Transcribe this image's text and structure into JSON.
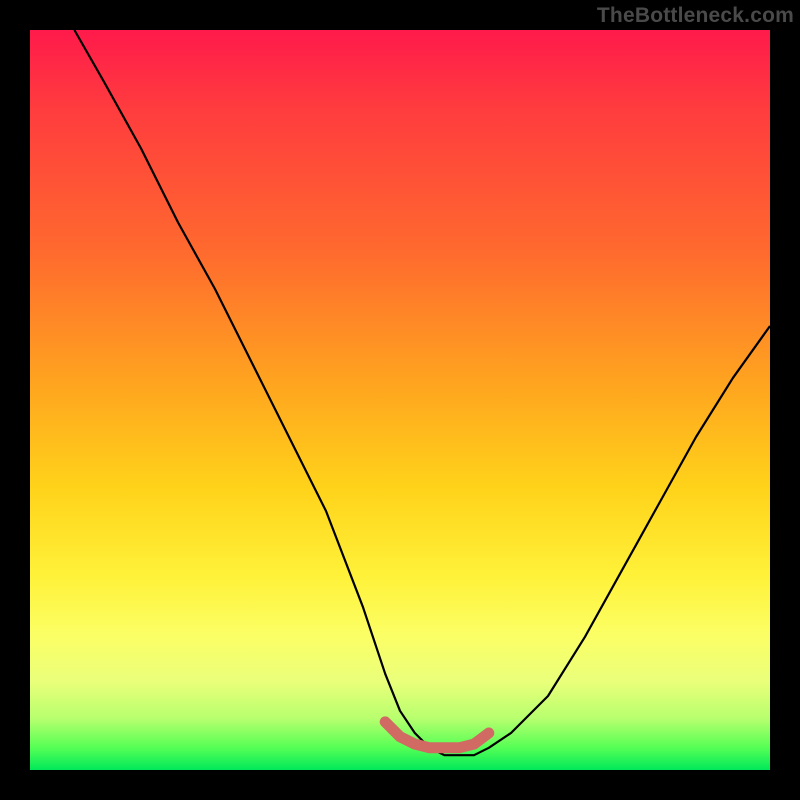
{
  "watermark": "TheBottleneck.com",
  "colors": {
    "gradient_top": "#ff1a4b",
    "gradient_mid1": "#ff6a2e",
    "gradient_mid2": "#ffd31a",
    "gradient_mid3": "#fbff66",
    "gradient_bottom": "#00e85a",
    "curve": "#000000",
    "marker": "#d16a63",
    "frame": "#000000"
  },
  "chart_data": {
    "type": "line",
    "title": "",
    "xlabel": "",
    "ylabel": "",
    "xlim": [
      0,
      100
    ],
    "ylim": [
      0,
      100
    ],
    "grid": false,
    "legend": false,
    "notes": "Axes are percentage-of-plot coordinates estimated from pixels; chart has no visible tick labels. Y=0 at the bottom (minimum / green), Y=100 at the top (maximum / red). Curve shows a steep descent from upper-left to a flat minimum near x≈55 then rises toward the right. The small salmon band near the bottom marks the flat/optimal region around the minimum.",
    "series": [
      {
        "name": "bottleneck-curve",
        "x": [
          6,
          10,
          15,
          20,
          25,
          30,
          35,
          40,
          45,
          48,
          50,
          52,
          54,
          56,
          58,
          60,
          62,
          65,
          70,
          75,
          80,
          85,
          90,
          95,
          100
        ],
        "y": [
          100,
          93,
          84,
          74,
          65,
          55,
          45,
          35,
          22,
          13,
          8,
          5,
          3,
          2,
          2,
          2,
          3,
          5,
          10,
          18,
          27,
          36,
          45,
          53,
          60
        ]
      }
    ],
    "marker_region": {
      "name": "optimal-band",
      "x": [
        48,
        50,
        52,
        54,
        56,
        58,
        60,
        62
      ],
      "y": [
        6.5,
        4.5,
        3.5,
        3.0,
        3.0,
        3.0,
        3.5,
        5.0
      ]
    }
  }
}
